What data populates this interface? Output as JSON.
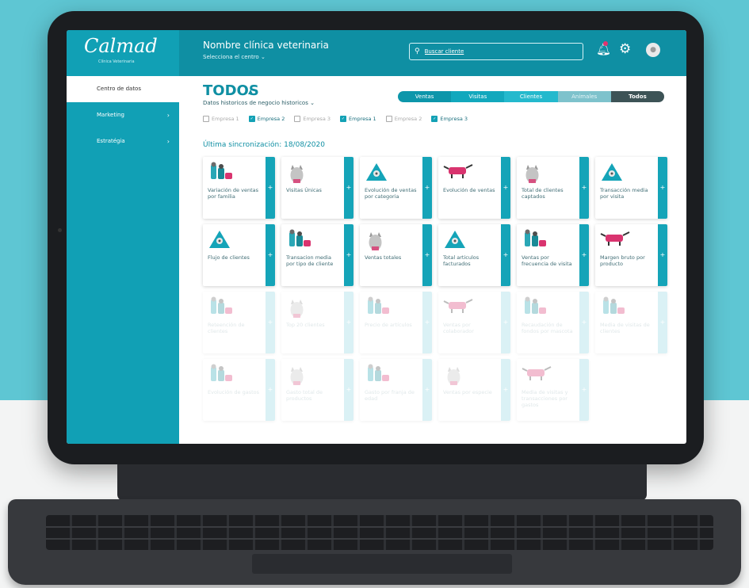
{
  "app": {
    "logo": "Calmad",
    "logo_sub": "Clínica Veterinaria",
    "clinic_name": "Nombre clínica veterinaria",
    "center_select": "Selecciona el centro",
    "search_placeholder": "Buscar cliente"
  },
  "sidebar": {
    "items": [
      {
        "label": "Centro de datos"
      },
      {
        "label": "Marketing"
      },
      {
        "label": "Estratégia"
      }
    ]
  },
  "main": {
    "title": "TODOS",
    "subtitle": "Datos historicos de negocio historicos",
    "companies": [
      {
        "label": "Empresa 1",
        "checked": false
      },
      {
        "label": "Empresa 2",
        "checked": true
      },
      {
        "label": "Empresa 3",
        "checked": false
      },
      {
        "label": "Empresa 1",
        "checked": true
      },
      {
        "label": "Empresa 2",
        "checked": false
      },
      {
        "label": "Empresa 3",
        "checked": true
      }
    ],
    "tabs": [
      "Ventas",
      "Visitas",
      "Clientes",
      "Animales",
      "Todos"
    ],
    "sync": "Última sincronización: 18/08/2020"
  },
  "cards": [
    {
      "label": "Variación de ventas por familia",
      "icon": "people-pet-icon",
      "faded": false
    },
    {
      "label": "Visitas Únicas",
      "icon": "cat-icon",
      "faded": false
    },
    {
      "label": "Evolución de ventas por categoria",
      "icon": "triangle-pet-icon",
      "faded": false
    },
    {
      "label": "Evolución de ventas",
      "icon": "dog-icon",
      "faded": false
    },
    {
      "label": "Total de clientes captados",
      "icon": "cat-icon",
      "faded": false
    },
    {
      "label": "Transacción media por visita",
      "icon": "triangle-pet-icon",
      "faded": false
    },
    {
      "label": "Flujo de clientes",
      "icon": "triangle-pet-icon",
      "faded": false
    },
    {
      "label": "Transacion media por tipo de cliente",
      "icon": "people-pet-icon",
      "faded": false
    },
    {
      "label": "Ventas totales",
      "icon": "cat-icon",
      "faded": false
    },
    {
      "label": "Total articulos facturados",
      "icon": "triangle-pet-icon",
      "faded": false
    },
    {
      "label": "Ventas por frecuencia de visita",
      "icon": "people-pet-icon",
      "faded": false
    },
    {
      "label": "Margen bruto por producto",
      "icon": "dog-icon",
      "faded": false
    },
    {
      "label": "Reteención de clientes",
      "icon": "people-pet-icon",
      "faded": true
    },
    {
      "label": "Top 20 clientes",
      "icon": "cat-icon",
      "faded": true
    },
    {
      "label": "Precio de artículos",
      "icon": "people-pet-icon",
      "faded": true
    },
    {
      "label": "Ventas por colaborador",
      "icon": "dog-icon",
      "faded": true
    },
    {
      "label": "Recaudación de fondos por mascota",
      "icon": "people-pet-icon",
      "faded": true
    },
    {
      "label": "Media de visitas de clientes",
      "icon": "people-pet-icon",
      "faded": true
    },
    {
      "label": "Evolución de gastos",
      "icon": "people-pet-icon",
      "faded": true
    },
    {
      "label": "Gasto total de productos",
      "icon": "cat-icon",
      "faded": true
    },
    {
      "label": "Gasto por franja de edad",
      "icon": "people-pet-icon",
      "faded": true
    },
    {
      "label": "Ventas por especie",
      "icon": "cat-icon",
      "faded": true
    },
    {
      "label": "Media de visitas y transacciones por gastos",
      "icon": "dog-icon",
      "faded": true
    }
  ],
  "colors": {
    "background": "#5ec6d3",
    "header": "#0f8fa3",
    "sidebar": "#11a0b5",
    "accent": "#15a4b8",
    "pink": "#d9346f"
  }
}
